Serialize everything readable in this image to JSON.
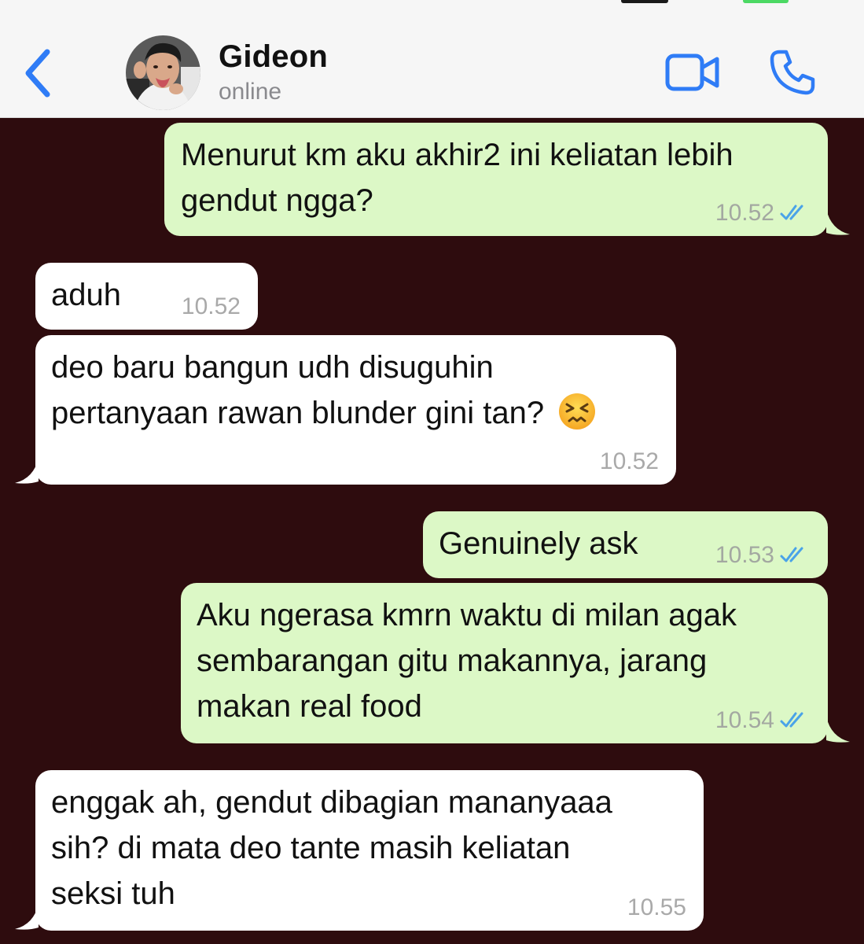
{
  "header": {
    "contact_name": "Gideon",
    "contact_status": "online",
    "icons": {
      "back": "chevron-left-icon",
      "video": "video-camera-icon",
      "call": "phone-icon"
    },
    "accent_color": "#2f7cf6"
  },
  "chat": {
    "background_color": "#2e0c0e",
    "outgoing_color": "#dcf8c6",
    "incoming_color": "#ffffff",
    "messages": [
      {
        "direction": "outgoing",
        "lines": [
          "Menurut km aku akhir2 ini keliatan lebih",
          "gendut ngga?"
        ],
        "time": "10.52",
        "read": true
      },
      {
        "direction": "incoming",
        "lines": [
          "aduh"
        ],
        "time": "10.52"
      },
      {
        "direction": "incoming",
        "lines": [
          "deo baru bangun udh disuguhin",
          "pertanyaan rawan blunder gini tan?"
        ],
        "emoji": "persevering-face-emoji",
        "time": "10.52"
      },
      {
        "direction": "outgoing",
        "lines": [
          "Genuinely ask"
        ],
        "time": "10.53",
        "read": true
      },
      {
        "direction": "outgoing",
        "lines": [
          "Aku ngerasa kmrn waktu di milan agak",
          "sembarangan gitu makannya, jarang",
          "makan real food"
        ],
        "time": "10.54",
        "read": true
      },
      {
        "direction": "incoming",
        "lines": [
          "enggak ah, gendut dibagian mananyaaa",
          "sih? di mata deo tante masih keliatan",
          "seksi tuh"
        ],
        "time": "10.55"
      }
    ]
  }
}
